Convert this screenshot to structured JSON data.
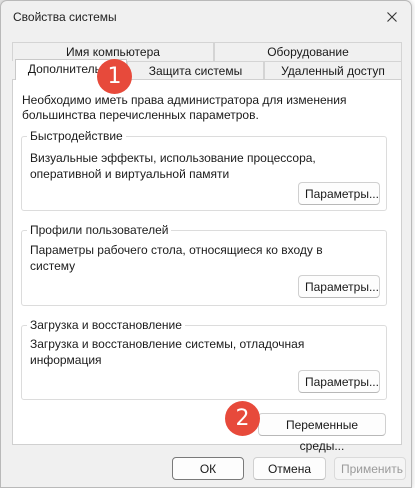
{
  "window": {
    "title": "Свойства системы"
  },
  "tabs": {
    "row_top": [
      "Имя компьютера",
      "Оборудование"
    ],
    "row_bottom": [
      "Дополнительно",
      "Защита системы",
      "Удаленный доступ"
    ]
  },
  "intro_text": "Необходимо иметь права администратора для изменения большинства перечисленных параметров.",
  "groups": {
    "performance": {
      "title": "Быстродействие",
      "text": "Визуальные эффекты, использование процессора, оперативной и виртуальной памяти",
      "button": "Параметры..."
    },
    "profiles": {
      "title": "Профили пользователей",
      "text": "Параметры рабочего стола, относящиеся ко входу в систему",
      "button": "Параметры..."
    },
    "startup": {
      "title": "Загрузка и восстановление",
      "text": "Загрузка и восстановление системы, отладочная информация",
      "button": "Параметры..."
    }
  },
  "env_button": "Переменные среды...",
  "footer": {
    "ok": "ОК",
    "cancel": "Отмена",
    "apply": "Применить"
  },
  "badges": [
    "1",
    "2"
  ],
  "colors": {
    "badge": "#e74a3b",
    "panel": "#ffffff",
    "window": "#f0f0f0"
  }
}
